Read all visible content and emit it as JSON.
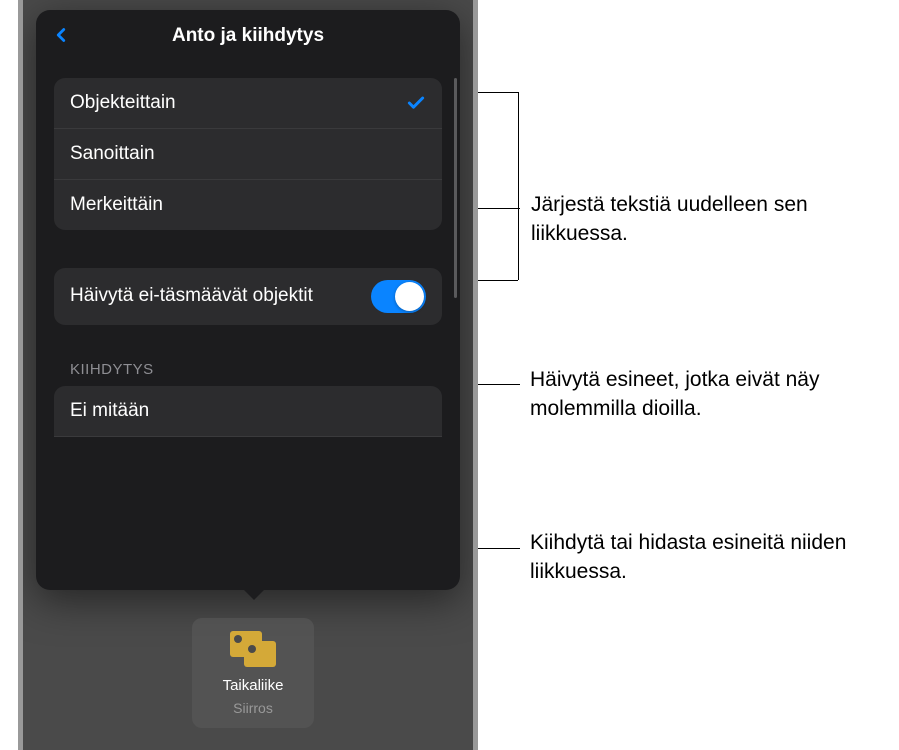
{
  "popover": {
    "title": "Anto ja kiihdytys",
    "options": [
      {
        "label": "Objekteittain",
        "selected": true
      },
      {
        "label": "Sanoittain",
        "selected": false
      },
      {
        "label": "Merkeittäin",
        "selected": false
      }
    ],
    "toggle": {
      "label": "Häivytä ei-täsmäävät objektit",
      "on": true
    },
    "section_header": "KIIHDYTYS",
    "acceleration": [
      {
        "label": "Ei mitään"
      }
    ]
  },
  "toolbar": {
    "transition_name": "Taikaliike",
    "transition_sub": "Siirros"
  },
  "callouts": {
    "c1": "Järjestä tekstiä uudelleen sen liikkuessa.",
    "c2": "Häivytä esineet, jotka eivät näy molemmilla dioilla.",
    "c3": "Kiihdytä tai hidasta esineitä niiden liikkuessa."
  }
}
